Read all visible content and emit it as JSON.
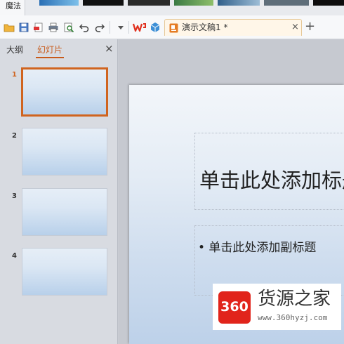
{
  "ribbon": {
    "active_tab": "魔法"
  },
  "toolbar": {
    "icons": [
      "open-folder-icon",
      "save-icon",
      "export-pdf-icon",
      "print-icon",
      "print-preview-icon",
      "undo-icon",
      "redo-icon",
      "dropdown-icon",
      "wps-logo-icon",
      "cube-icon"
    ]
  },
  "document_tab": {
    "title": "演示文稿1 *",
    "close": "×"
  },
  "new_tab": "+",
  "left_panel": {
    "tabs": [
      "大纲",
      "幻灯片"
    ],
    "active_tab": "幻灯片",
    "close": "×",
    "slides": [
      {
        "number": "1",
        "selected": true
      },
      {
        "number": "2",
        "selected": false
      },
      {
        "number": "3",
        "selected": false
      },
      {
        "number": "4",
        "selected": false
      }
    ]
  },
  "slide": {
    "title_placeholder": "单击此处添加标题",
    "subtitle_placeholder": "• 单击此处添加副标题"
  },
  "watermark": {
    "logo": "360",
    "site_name": "货源之家",
    "url": "www.360hyzj.com"
  },
  "colors": {
    "accent": "#d0641f",
    "slide_gradient_bottom": "#bdd1e9",
    "logo_red": "#e1241b"
  }
}
